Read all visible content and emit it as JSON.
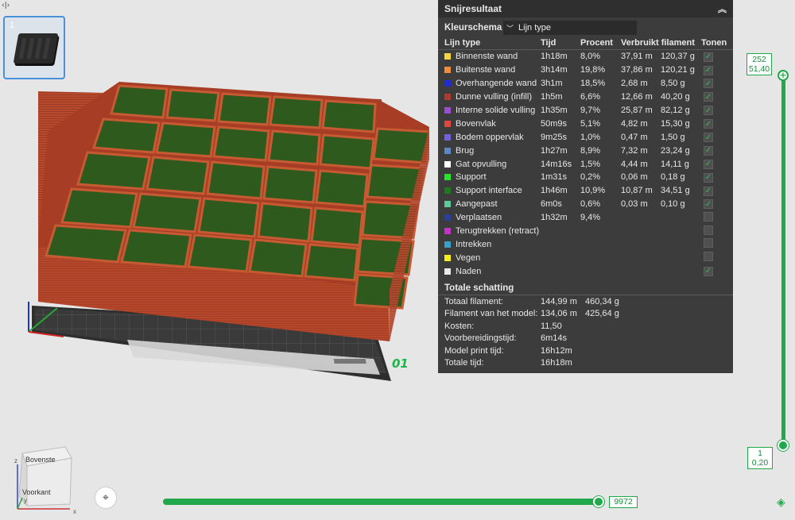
{
  "thumbnail": {
    "number": "1"
  },
  "plate": {
    "number": "01"
  },
  "panel": {
    "title": "Snijresultaat",
    "scheme_label": "Kleurschema",
    "scheme_value": "Lijn type",
    "columns": {
      "type": "Lijn type",
      "time": "Tijd",
      "percent": "Procent",
      "filament": "Verbruikt filament",
      "show": "Tonen"
    },
    "rows": [
      {
        "name": "Binnenste wand",
        "color": "#f5d63d",
        "time": "1h18m",
        "percent": "8,0%",
        "length": "37,91 m",
        "weight": "120,37 g",
        "checked": true,
        "show_check": true
      },
      {
        "name": "Buitenste wand",
        "color": "#f08c3a",
        "time": "3h14m",
        "percent": "19,8%",
        "length": "37,86 m",
        "weight": "120,21 g",
        "checked": true,
        "show_check": true
      },
      {
        "name": "Overhangende wand",
        "color": "#1f2bd6",
        "time": "3h1m",
        "percent": "18,5%",
        "length": "2,68 m",
        "weight": "8,50 g",
        "checked": true,
        "show_check": true
      },
      {
        "name": "Dunne vulling (infill)",
        "color": "#b03a2e",
        "time": "1h5m",
        "percent": "6,6%",
        "length": "12,66 m",
        "weight": "40,20 g",
        "checked": true,
        "show_check": true
      },
      {
        "name": "Interne solide vulling",
        "color": "#9a4fd1",
        "time": "1h35m",
        "percent": "9,7%",
        "length": "25,87 m",
        "weight": "82,12 g",
        "checked": true,
        "show_check": true
      },
      {
        "name": "Bovenvlak",
        "color": "#e0473d",
        "time": "50m9s",
        "percent": "5,1%",
        "length": "4,82 m",
        "weight": "15,30 g",
        "checked": true,
        "show_check": true
      },
      {
        "name": "Bodem oppervlak",
        "color": "#6f63d9",
        "time": "9m25s",
        "percent": "1,0%",
        "length": "0,47 m",
        "weight": "1,50 g",
        "checked": true,
        "show_check": true
      },
      {
        "name": "Brug",
        "color": "#5d86c2",
        "time": "1h27m",
        "percent": "8,9%",
        "length": "7,32 m",
        "weight": "23,24 g",
        "checked": true,
        "show_check": true
      },
      {
        "name": "Gat opvulling",
        "color": "#ffffff",
        "time": "14m16s",
        "percent": "1,5%",
        "length": "4,44 m",
        "weight": "14,11 g",
        "checked": true,
        "show_check": true
      },
      {
        "name": "Support",
        "color": "#23e62a",
        "time": "1m31s",
        "percent": "0,2%",
        "length": "0,06 m",
        "weight": "0,18 g",
        "checked": true,
        "show_check": true
      },
      {
        "name": "Support interface",
        "color": "#1e7a1e",
        "time": "1h46m",
        "percent": "10,9%",
        "length": "10,87 m",
        "weight": "34,51 g",
        "checked": true,
        "show_check": true
      },
      {
        "name": "Aangepast",
        "color": "#5ec99b",
        "time": "6m0s",
        "percent": "0,6%",
        "length": "0,03 m",
        "weight": "0,10 g",
        "checked": true,
        "show_check": true
      },
      {
        "name": "Verplaatsen",
        "color": "#2a3f9c",
        "time": "1h32m",
        "percent": "9,4%",
        "length": "",
        "weight": "",
        "checked": false,
        "show_check": true
      },
      {
        "name": "Terugtrekken (retract)",
        "color": "#c434c4",
        "time": "",
        "percent": "",
        "length": "",
        "weight": "",
        "checked": false,
        "show_check": true
      },
      {
        "name": "Intrekken",
        "color": "#3aa0c9",
        "time": "",
        "percent": "",
        "length": "",
        "weight": "",
        "checked": false,
        "show_check": true
      },
      {
        "name": "Vegen",
        "color": "#f2ee1a",
        "time": "",
        "percent": "",
        "length": "",
        "weight": "",
        "checked": false,
        "show_check": true
      },
      {
        "name": "Naden",
        "color": "#e8e8e8",
        "time": "",
        "percent": "",
        "length": "",
        "weight": "",
        "checked": true,
        "show_check": true
      }
    ],
    "total_title": "Totale schatting",
    "totals": [
      {
        "label": "Totaal filament:",
        "v1": "144,99 m",
        "v2": "460,34 g"
      },
      {
        "label": "Filament van het model:",
        "v1": "134,06 m",
        "v2": "425,64 g"
      },
      {
        "label": "Kosten:",
        "v1": "11,50",
        "v2": ""
      },
      {
        "label": "Voorbereidingstijd:",
        "v1": "6m14s",
        "v2": ""
      },
      {
        "label": "Model print tijd:",
        "v1": "16h12m",
        "v2": ""
      },
      {
        "label": "Totale tijd:",
        "v1": "16h18m",
        "v2": ""
      }
    ]
  },
  "layer_slider": {
    "top_layer": "252",
    "top_height": "51,40",
    "bottom_layer": "1",
    "bottom_height": "0,20"
  },
  "move_slider": {
    "value": "9972"
  },
  "nav_cube": {
    "top": "Bovenste",
    "front": "Voorkant",
    "axis_z": "z",
    "axis_y": "y",
    "axis_x": "x"
  },
  "icons": {
    "corner": "code-toggle-icon",
    "collapse": "chevron-up-double-icon",
    "fit": "fit-view-icon",
    "layers": "layers-icon"
  }
}
